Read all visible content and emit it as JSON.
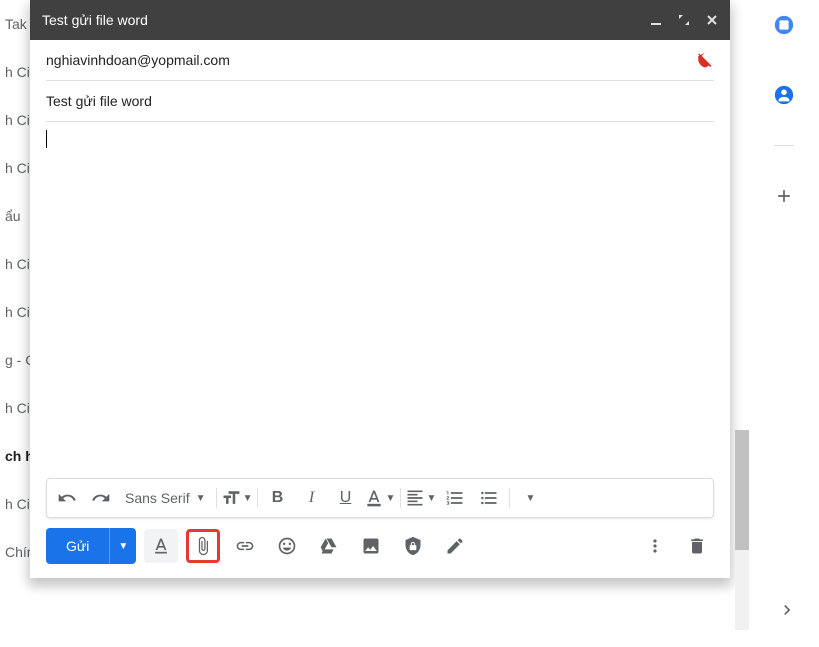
{
  "bg": {
    "items": [
      "Tak",
      "h Ci",
      "h Ci",
      "h Ci",
      "ẩu",
      "h Ci",
      "h Ci",
      "g - C",
      "h Ci",
      "ch h",
      "h Ci",
      "Chín"
    ],
    "boldIndex": 9
  },
  "compose": {
    "title": "Test gửi file word",
    "to": "nghiavinhdoan@yopmail.com",
    "subject": "Test gửi file word",
    "body": "",
    "font": "Sans Serif",
    "send_label": "Gửi"
  }
}
